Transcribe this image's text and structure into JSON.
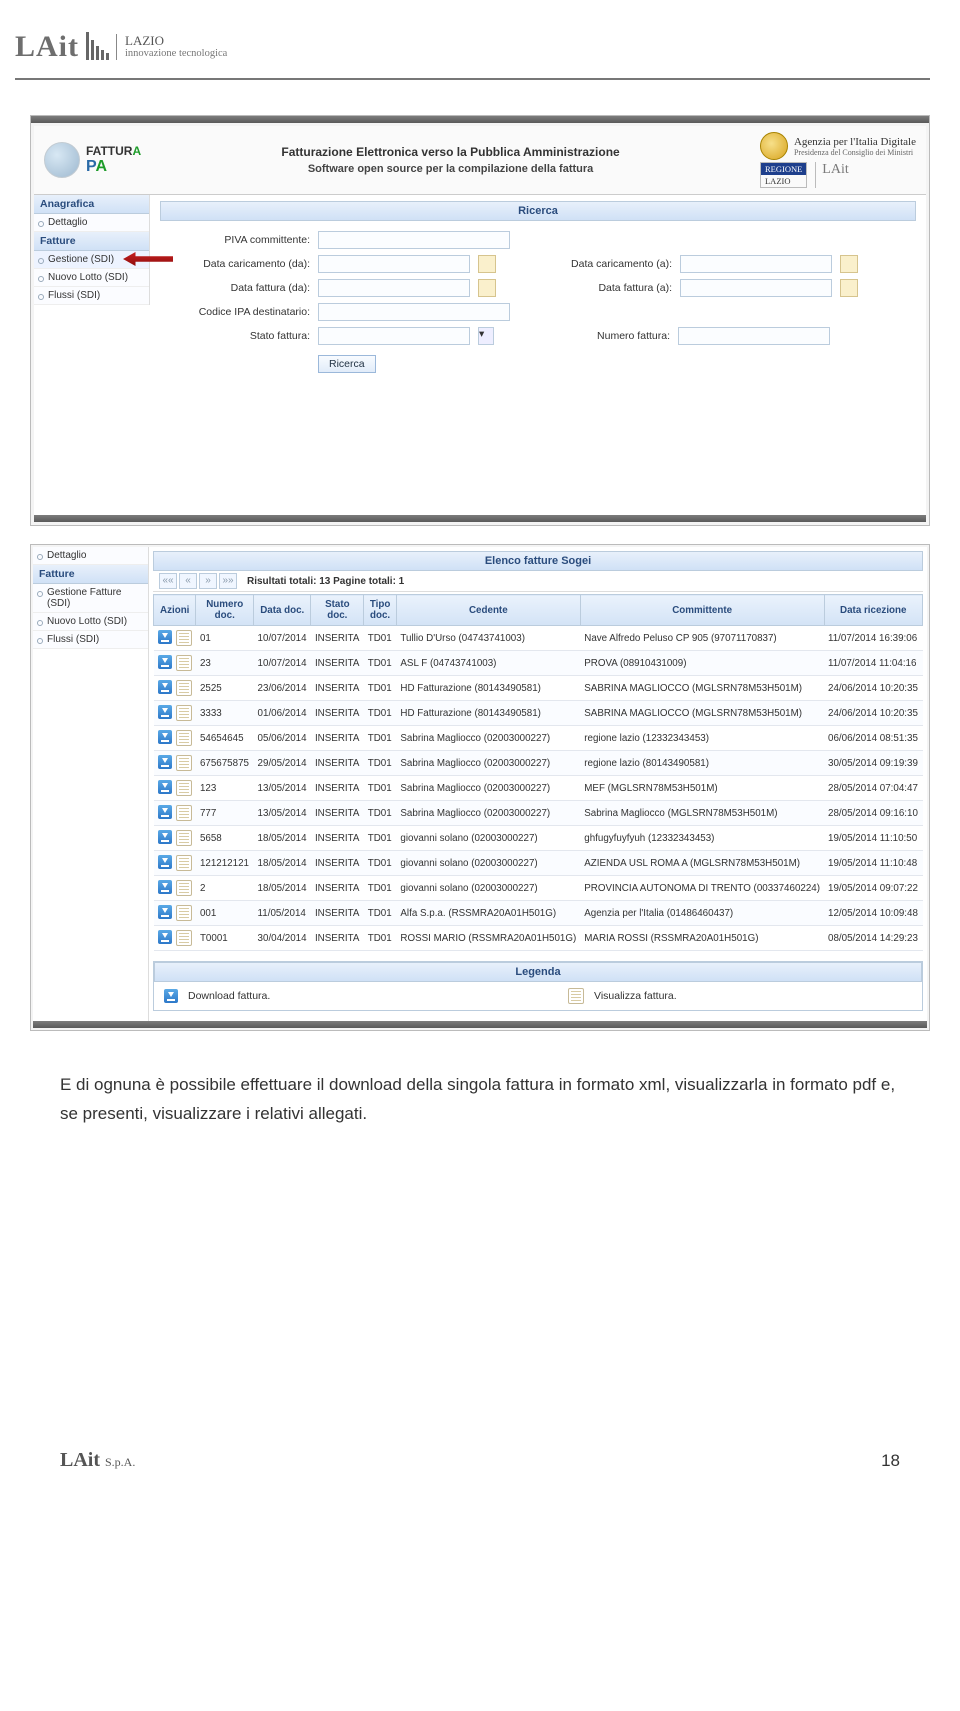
{
  "logo": {
    "brand": "LAit",
    "region": "LAZIO",
    "tagline": "innovazione tecnologica"
  },
  "app": {
    "title": "Fatturazione Elettronica verso la Pubblica Amministrazione",
    "subtitle": "Software open source per la compilazione della fattura",
    "agid": {
      "name": "Agenzia per l'Italia Digitale",
      "sub": "Presidenza del Consiglio dei Ministri"
    },
    "regione_top": "REGIONE",
    "regione_bot": "LAZIO",
    "lait": "LAit"
  },
  "sidebar": {
    "anagrafica": "Anagrafica",
    "dettaglio": "Dettaglio",
    "fatture": "Fatture",
    "items": [
      {
        "label": "Gestione (SDI)"
      },
      {
        "label": "Nuovo Lotto (SDI)"
      },
      {
        "label": "Flussi (SDI)"
      }
    ]
  },
  "search": {
    "panel": "Ricerca",
    "piva": "PIVA committente:",
    "dc_da": "Data caricamento (da):",
    "dc_a": "Data caricamento (a):",
    "df_da": "Data fattura (da):",
    "df_a": "Data fattura (a):",
    "ipa": "Codice IPA destinatario:",
    "stato": "Stato fattura:",
    "numero": "Numero fattura:",
    "btn": "Ricerca"
  },
  "sidebar2": {
    "dettaglio": "Dettaglio",
    "fatture": "Fatture",
    "items": [
      {
        "label": "Gestione Fatture (SDI)"
      },
      {
        "label": "Nuovo Lotto (SDI)"
      },
      {
        "label": "Flussi (SDI)"
      }
    ]
  },
  "list": {
    "panel": "Elenco fatture Sogei",
    "pager": {
      "first": "««",
      "prev": "«",
      "next": "»",
      "last": "»»",
      "label": "Risultati totali: 13 Pagine totali: 1"
    },
    "cols": {
      "azioni": "Azioni",
      "num": "Numero doc.",
      "data": "Data doc.",
      "stato": "Stato doc.",
      "tipo": "Tipo doc.",
      "ced": "Cedente",
      "comm": "Committente",
      "ric": "Data ricezione"
    },
    "rows": [
      {
        "num": "01",
        "data": "10/07/2014",
        "stato": "INSERITA",
        "tipo": "TD01",
        "ced": "Tullio D'Urso (04743741003)",
        "comm": "Nave Alfredo Peluso CP 905 (97071170837)",
        "ric": "11/07/2014 16:39:06"
      },
      {
        "num": "23",
        "data": "10/07/2014",
        "stato": "INSERITA",
        "tipo": "TD01",
        "ced": "ASL F (04743741003)",
        "comm": "PROVA (08910431009)",
        "ric": "11/07/2014 11:04:16"
      },
      {
        "num": "2525",
        "data": "23/06/2014",
        "stato": "INSERITA",
        "tipo": "TD01",
        "ced": "HD Fatturazione (80143490581)",
        "comm": "SABRINA MAGLIOCCO (MGLSRN78M53H501M)",
        "ric": "24/06/2014 10:20:35"
      },
      {
        "num": "3333",
        "data": "01/06/2014",
        "stato": "INSERITA",
        "tipo": "TD01",
        "ced": "HD Fatturazione (80143490581)",
        "comm": "SABRINA MAGLIOCCO (MGLSRN78M53H501M)",
        "ric": "24/06/2014 10:20:35"
      },
      {
        "num": "54654645",
        "data": "05/06/2014",
        "stato": "INSERITA",
        "tipo": "TD01",
        "ced": "Sabrina Magliocco (02003000227)",
        "comm": "regione lazio (12332343453)",
        "ric": "06/06/2014 08:51:35"
      },
      {
        "num": "675675875",
        "data": "29/05/2014",
        "stato": "INSERITA",
        "tipo": "TD01",
        "ced": "Sabrina Magliocco (02003000227)",
        "comm": "regione lazio (80143490581)",
        "ric": "30/05/2014 09:19:39"
      },
      {
        "num": "123",
        "data": "13/05/2014",
        "stato": "INSERITA",
        "tipo": "TD01",
        "ced": "Sabrina Magliocco (02003000227)",
        "comm": "MEF (MGLSRN78M53H501M)",
        "ric": "28/05/2014 07:04:47"
      },
      {
        "num": "777",
        "data": "13/05/2014",
        "stato": "INSERITA",
        "tipo": "TD01",
        "ced": "Sabrina Magliocco (02003000227)",
        "comm": "Sabrina Magliocco (MGLSRN78M53H501M)",
        "ric": "28/05/2014 09:16:10"
      },
      {
        "num": "5658",
        "data": "18/05/2014",
        "stato": "INSERITA",
        "tipo": "TD01",
        "ced": "giovanni solano (02003000227)",
        "comm": "ghfugyfuyfyuh (12332343453)",
        "ric": "19/05/2014 11:10:50"
      },
      {
        "num": "121212121",
        "data": "18/05/2014",
        "stato": "INSERITA",
        "tipo": "TD01",
        "ced": "giovanni solano (02003000227)",
        "comm": "AZIENDA USL ROMA A (MGLSRN78M53H501M)",
        "ric": "19/05/2014 11:10:48"
      },
      {
        "num": "2",
        "data": "18/05/2014",
        "stato": "INSERITA",
        "tipo": "TD01",
        "ced": "giovanni solano (02003000227)",
        "comm": "PROVINCIA AUTONOMA DI TRENTO (00337460224)",
        "ric": "19/05/2014 09:07:22"
      },
      {
        "num": "001",
        "data": "11/05/2014",
        "stato": "INSERITA",
        "tipo": "TD01",
        "ced": "Alfa S.p.a. (RSSMRA20A01H501G)",
        "comm": "Agenzia per l'Italia (01486460437)",
        "ric": "12/05/2014 10:09:48"
      },
      {
        "num": "T0001",
        "data": "30/04/2014",
        "stato": "INSERITA",
        "tipo": "TD01",
        "ced": "ROSSI MARIO (RSSMRA20A01H501G)",
        "comm": "MARIA ROSSI (RSSMRA20A01H501G)",
        "ric": "08/05/2014 14:29:23"
      }
    ]
  },
  "legend": {
    "title": "Legenda",
    "dl": "Download fattura.",
    "view": "Visualizza fattura."
  },
  "caption": "E di ognuna è possibile effettuare il download della singola fattura in formato xml, visualizzarla in formato pdf e, se presenti, visualizzare i relativi allegati.",
  "footer": {
    "brand": "LAit",
    "suffix": "S.p.A.",
    "page": "18"
  }
}
